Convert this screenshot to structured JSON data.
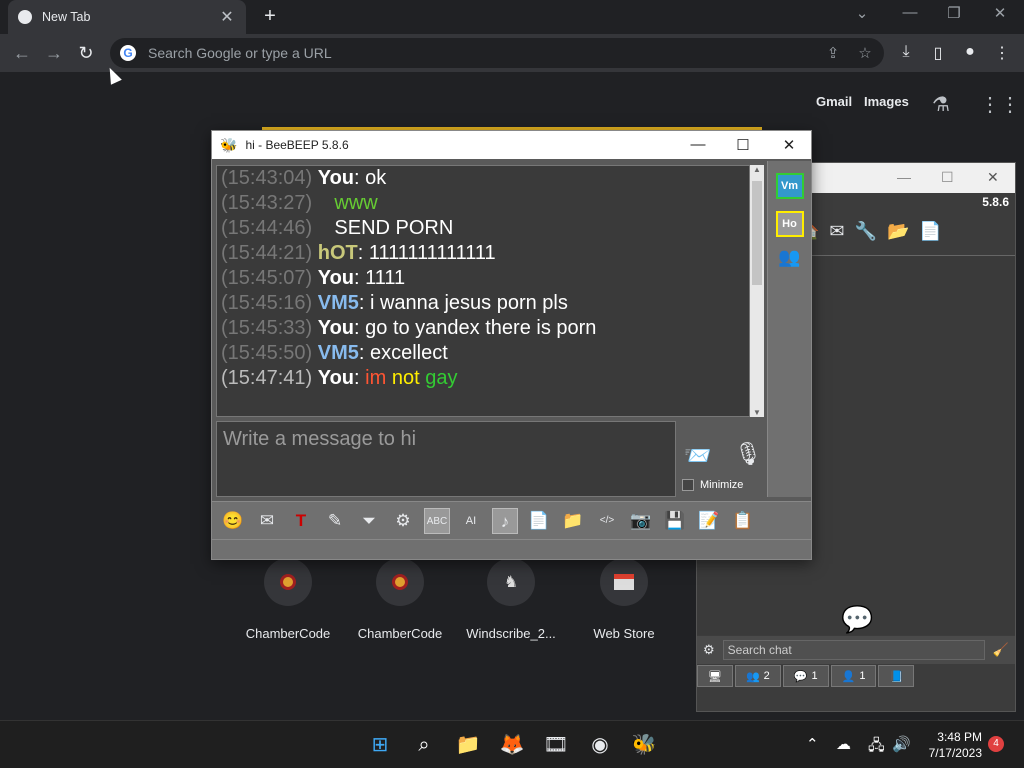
{
  "browser": {
    "tab_title": "New Tab",
    "tab_close": "✕",
    "new_tab": "+",
    "omnibox_placeholder": "Search Google or type a URL"
  },
  "ntp": {
    "gmail": "Gmail",
    "images": "Images",
    "shortcuts": [
      {
        "label": "ChamberCode"
      },
      {
        "label": "ChamberCode"
      },
      {
        "label": "Windscribe_2..."
      },
      {
        "label": "Web Store"
      }
    ]
  },
  "chat_window": {
    "title": "hi - BeeBEEP 5.8.6",
    "messages": [
      {
        "ts": "(15:43:04)",
        "user": "You",
        "text": ": ok",
        "user_color": "#ffffff",
        "text_color": "#ffffff"
      },
      {
        "ts": "(15:43:27)",
        "user": "",
        "text": "   www",
        "user_color": "#ffffff",
        "text_color": "#66cc33"
      },
      {
        "ts": "(15:44:46)",
        "user": "",
        "text": "   SEND PORN",
        "user_color": "#ffffff",
        "text_color": "#ffffff"
      },
      {
        "ts": "(15:44:21)",
        "user": "hOT",
        "text": ": 1111111111111",
        "user_color": "#c8c87a",
        "text_color": "#ffffff"
      },
      {
        "ts": "(15:45:07)",
        "user": "You",
        "text": ": 1111",
        "user_color": "#ffffff",
        "text_color": "#ffffff"
      },
      {
        "ts": "(15:45:16)",
        "user": "VM5",
        "text": ": i wanna jesus porn pls",
        "user_color": "#88bbee",
        "text_color": "#ffffff"
      },
      {
        "ts": "(15:45:33)",
        "user": "You",
        "text": ": go to yandex there is porn",
        "user_color": "#ffffff",
        "text_color": "#ffffff"
      },
      {
        "ts": "(15:45:50)",
        "user": "VM5",
        "text": ": excellect",
        "user_color": "#88bbee",
        "text_color": "#ffffff"
      }
    ],
    "last_message": {
      "ts": "(15:47:41)",
      "user": "You",
      "sep": ": ",
      "rainbow": [
        "im",
        " ",
        "not",
        " ",
        "gay"
      ],
      "rainbow_colors": [
        "#ff5533",
        "#ffaa00",
        "#ffee00",
        "#ffffff",
        "#33cc33",
        "#33aaff",
        "#3355ff"
      ]
    },
    "write_placeholder": "Write a message to hi",
    "minimize_label": "Minimize",
    "side_buttons": [
      {
        "label": "Vm",
        "border": "#33cc33",
        "bg": "#3399cc"
      },
      {
        "label": "Ho",
        "border": "#ffee00",
        "bg": "#999999"
      }
    ]
  },
  "bg_window": {
    "version": "5.8.6",
    "search_placeholder": "Search chat",
    "tabs": [
      {
        "icon": "🖥",
        "count": ""
      },
      {
        "icon": "👥",
        "count": "2"
      },
      {
        "icon": "💬",
        "count": "1"
      },
      {
        "icon": "👤",
        "count": "1"
      },
      {
        "icon": "📘",
        "count": ""
      }
    ]
  },
  "taskbar": {
    "time": "3:48 PM",
    "date": "7/17/2023",
    "notifications": "4"
  }
}
